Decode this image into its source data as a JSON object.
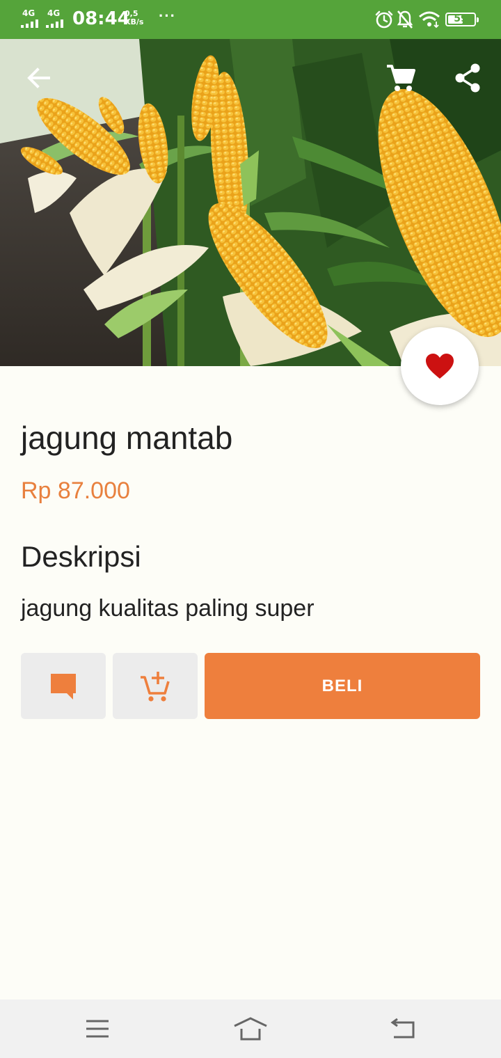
{
  "status_bar": {
    "network_1": "4G",
    "network_2": "4G",
    "time": "08:44",
    "speed_value": "0,5",
    "speed_unit": "KB/s",
    "more": "···",
    "battery_level": "59",
    "battery_fraction": 0.59
  },
  "product": {
    "name": "jagung mantab",
    "price": "Rp 87.000",
    "description_heading": "Deskripsi",
    "description": "jagung kualitas paling super"
  },
  "actions": {
    "buy_label": "BELI"
  },
  "colors": {
    "status_bar": "#55a43a",
    "accent": "#ee7f3d",
    "price": "#e8803e",
    "favorite": "#cc1111",
    "background": "#fdfdf7"
  },
  "icons": {
    "back": "arrow-left-icon",
    "cart": "cart-icon",
    "share": "share-icon",
    "favorite": "heart-icon",
    "chat": "chat-icon",
    "add_to_cart": "add-cart-icon",
    "menu": "menu-icon",
    "home": "home-icon",
    "back_nav": "back-icon"
  }
}
